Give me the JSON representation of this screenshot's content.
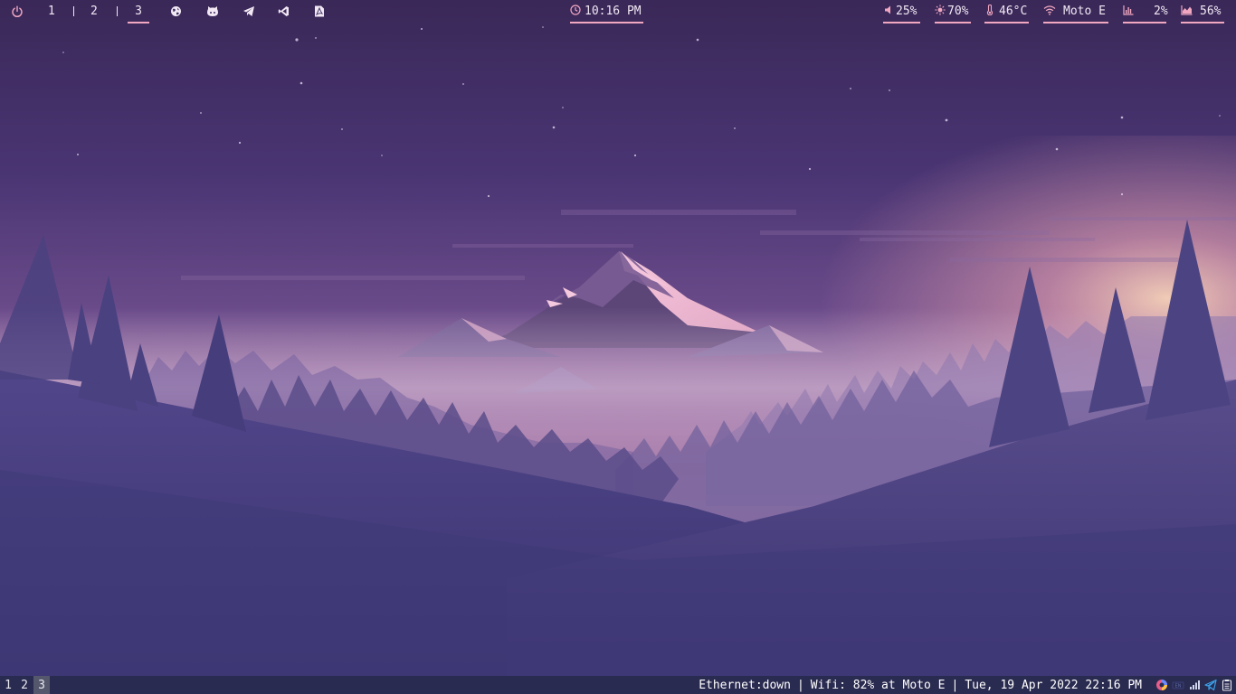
{
  "topbar": {
    "workspaces": [
      "1",
      "2",
      "3"
    ],
    "active_workspace": "3",
    "launchers": [
      "globe-icon",
      "github-icon",
      "telegram-icon",
      "vscode-icon",
      "pdf-icon"
    ],
    "clock": "10:16 PM",
    "volume": "25%",
    "brightness": "70%",
    "temperature": "46°C",
    "wifi": "Moto E",
    "cpu": "2%",
    "memory": "56%",
    "accent_color": "#f1a7c0",
    "text_color": "#f1e8f4"
  },
  "bottombar": {
    "workspaces": [
      "1",
      "2",
      "3"
    ],
    "active_workspace": "3",
    "ethernet": "Ethernet:down",
    "wifi": "Wifi: 82% at Moto E",
    "datetime": "Tue, 19 Apr 2022 22:16 PM",
    "tray": [
      "color-picker-icon",
      "keyboard-layout-icon",
      "signal-icon",
      "telegram-icon",
      "clipboard-icon"
    ],
    "background_color": "#2a2b50"
  }
}
